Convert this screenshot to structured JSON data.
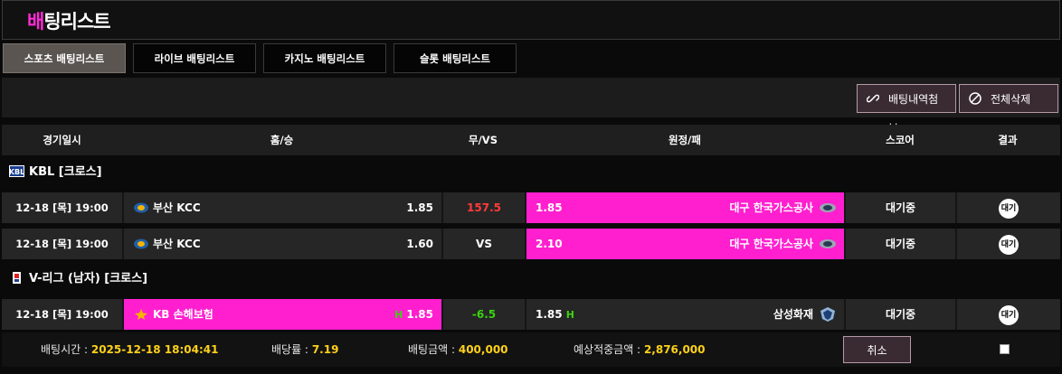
{
  "page": {
    "title_accent": "배",
    "title_rest": "팅리스트"
  },
  "tabs": [
    {
      "label": "스포츠 배팅리스트",
      "active": true
    },
    {
      "label": "라이브 배팅리스트",
      "active": false
    },
    {
      "label": "카지노 배팅리스트",
      "active": false
    },
    {
      "label": "슬롯 배팅리스트",
      "active": false
    }
  ],
  "toolbar": {
    "attach_label": "배팅내역첨부",
    "delete_all_label": "전체삭제"
  },
  "table": {
    "headers": [
      "경기일시",
      "홈/승",
      "무/VS",
      "원정/패",
      "스코어",
      "결과"
    ]
  },
  "leagues": [
    {
      "name": "KBL [크로스]",
      "icon": "kbl-logo-icon",
      "rows": [
        {
          "date": "12-18 [목] 19:00",
          "home": "부산 KCC",
          "home_odds": "1.85",
          "mid": "157.5",
          "mid_color": "#ff3b3b",
          "away_odds": "1.85",
          "away": "대구 한국가스공사",
          "score": "대기중",
          "result": "대기",
          "selected": "away"
        },
        {
          "date": "12-18 [목] 19:00",
          "home": "부산 KCC",
          "home_odds": "1.60",
          "mid": "VS",
          "mid_color": "#ffffff",
          "away_odds": "2.10",
          "away": "대구 한국가스공사",
          "score": "대기중",
          "result": "대기",
          "selected": "away"
        }
      ]
    },
    {
      "name": "V-리그 (남자) [크로스]",
      "icon": "vleague-logo-icon",
      "rows": [
        {
          "date": "12-18 [목] 19:00",
          "home": "KB 손해보험",
          "home_mark": "H",
          "home_odds": "1.85",
          "mid": "-6.5",
          "mid_color": "#39d30d",
          "away_odds": "1.85",
          "away_mark": "H",
          "away": "삼성화재",
          "score": "대기중",
          "result": "대기",
          "selected": "home"
        }
      ]
    }
  ],
  "footer": {
    "bet_time_label": "배팅시간 :",
    "bet_time": "2025-12-18 18:04:41",
    "odds_label": "배당률 :",
    "odds": "7.19",
    "amount_label": "배팅금액 :",
    "amount": "400,000",
    "expected_label": "예상적중금액 :",
    "expected": "2,876,000",
    "cancel_label": "취소"
  },
  "colors": {
    "accent": "#ff1fcf",
    "highlight": "#ffd11a",
    "green": "#39d30d",
    "red": "#ff3b3b"
  }
}
